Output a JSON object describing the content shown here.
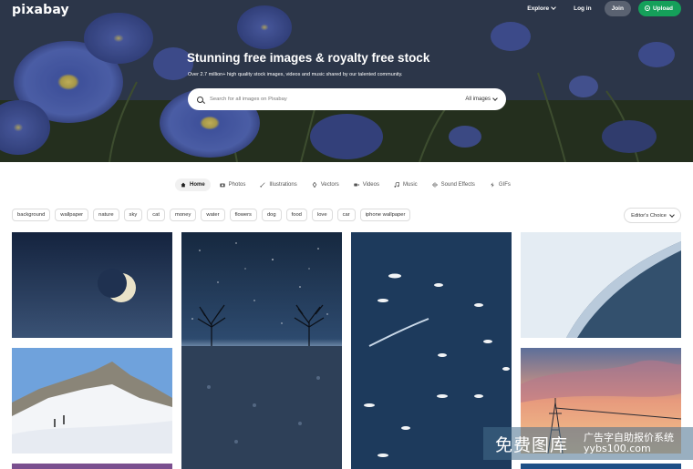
{
  "header": {
    "logo_text": "pixabay",
    "explore_label": "Explore",
    "login_label": "Log in",
    "join_label": "Join",
    "upload_label": "Upload"
  },
  "hero": {
    "headline": "Stunning free images & royalty free stock",
    "subline": "Over 2.7 million+ high quality stock images, videos and music shared by our talented community.",
    "search_placeholder": "Search for all images on Pixabay",
    "search_filter_label": "All images"
  },
  "tabs": [
    {
      "label": "Home",
      "icon": "home-icon",
      "active": true
    },
    {
      "label": "Photos",
      "icon": "camera-icon",
      "active": false
    },
    {
      "label": "Illustrations",
      "icon": "brush-icon",
      "active": false
    },
    {
      "label": "Vectors",
      "icon": "pen-icon",
      "active": false
    },
    {
      "label": "Videos",
      "icon": "video-icon",
      "active": false
    },
    {
      "label": "Music",
      "icon": "music-icon",
      "active": false
    },
    {
      "label": "Sound Effects",
      "icon": "sound-wave-icon",
      "active": false
    },
    {
      "label": "GIFs",
      "icon": "gif-icon",
      "active": false
    }
  ],
  "chips": [
    "background",
    "wallpaper",
    "nature",
    "sky",
    "cat",
    "money",
    "water",
    "flowers",
    "dog",
    "food",
    "love",
    "car",
    "iphone wallpaper"
  ],
  "sort_label": "Editor's Choice",
  "watermark": {
    "left": "免费图库",
    "right_line1": "广告字自助报价系统",
    "right_line2": "yybs100.com"
  },
  "colors": {
    "upload_green": "#15a05a",
    "hero_flower_blue": "#5b72c9"
  }
}
